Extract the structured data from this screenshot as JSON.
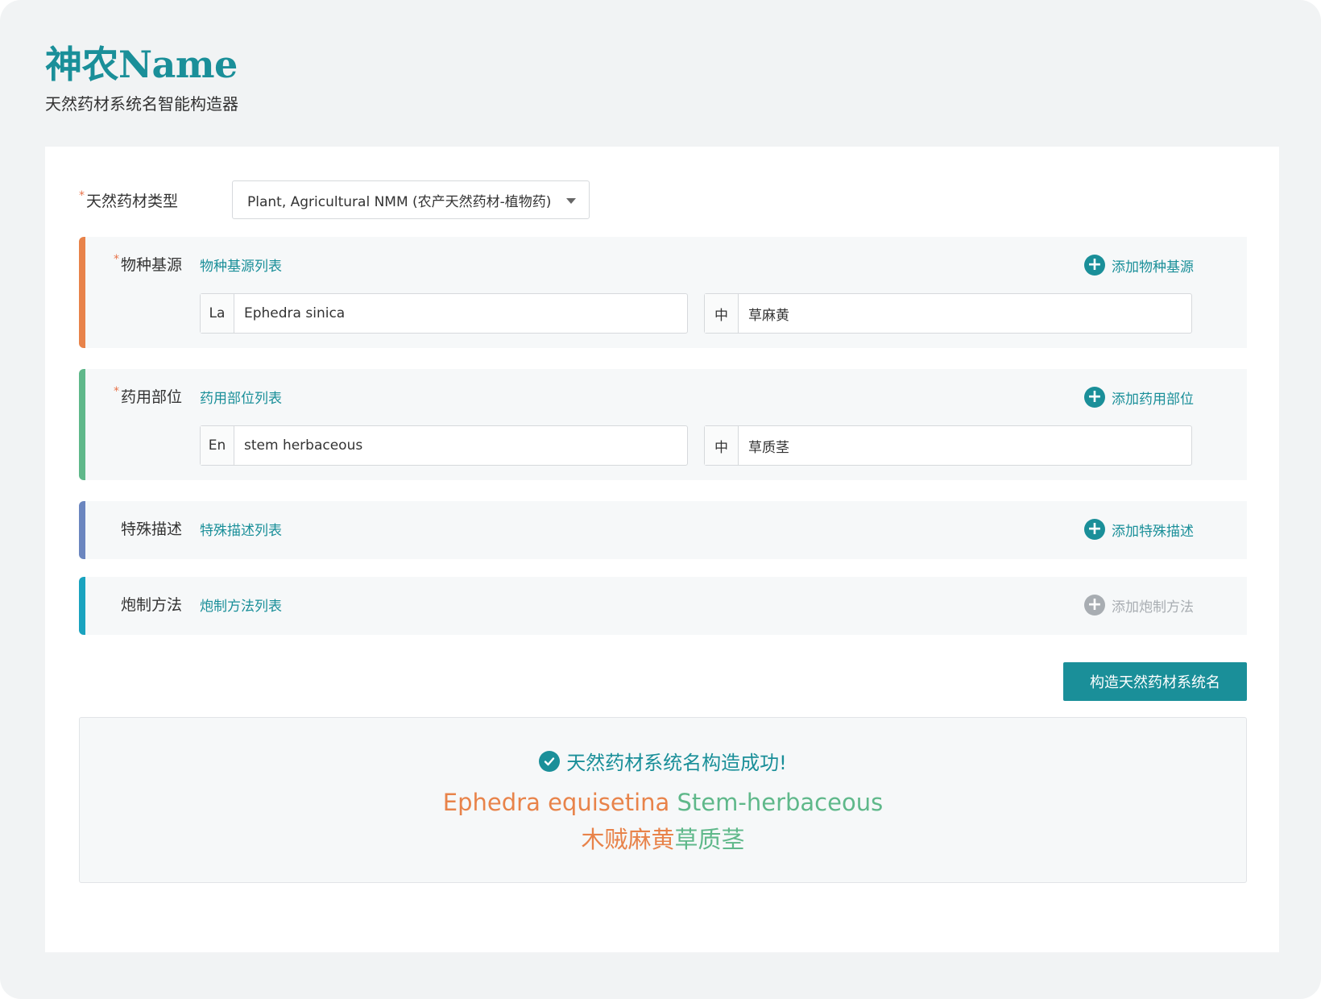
{
  "app": {
    "title": "神农Name",
    "subtitle": "天然药材系统名智能构造器"
  },
  "type_field": {
    "required_mark": "*",
    "label": "天然药材类型",
    "selected": "Plant, Agricultural NMM (农产天然药材-植物药)"
  },
  "sections": {
    "species": {
      "required_mark": "*",
      "label": "物种基源",
      "list_link": "物种基源列表",
      "add_label": "添加物种基源",
      "accent": "#e8834a",
      "latin_prefix": "La",
      "latin_value": "Ephedra sinica",
      "cn_prefix": "中",
      "cn_value": "草麻黄"
    },
    "part": {
      "required_mark": "*",
      "label": "药用部位",
      "list_link": "药用部位列表",
      "add_label": "添加药用部位",
      "accent": "#5fb88a",
      "en_prefix": "En",
      "en_value": "stem herbaceous",
      "cn_prefix": "中",
      "cn_value": "草质茎"
    },
    "special": {
      "label": "特殊描述",
      "list_link": "特殊描述列表",
      "add_label": "添加特殊描述",
      "accent": "#6b86bf"
    },
    "processing": {
      "label": "炮制方法",
      "list_link": "炮制方法列表",
      "add_label": "添加炮制方法",
      "accent": "#1aa3bf"
    }
  },
  "build_button": "构造天然药材系统名",
  "result": {
    "status": "天然药材系统名构造成功!",
    "latin_species": "Ephedra equisetina",
    "latin_part": "Stem-herbaceous",
    "cn_species": "木贼麻黄",
    "cn_part": "草质茎"
  },
  "colors": {
    "brand": "#1a8f99",
    "species": "#e8834a",
    "part": "#5fb88a",
    "disabled": "#a8adb2"
  }
}
